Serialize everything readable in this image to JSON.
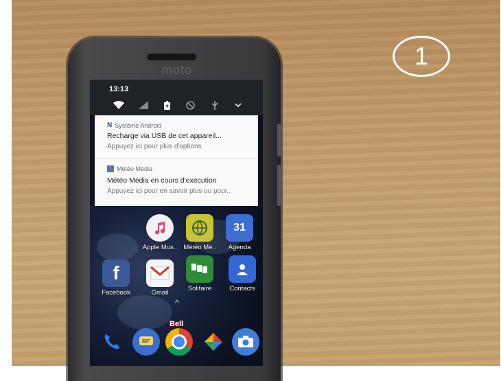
{
  "step_badge": "1",
  "phone": {
    "brand": "moto"
  },
  "statusbar": {
    "time": "13:13",
    "quick_settings": [
      "wifi-icon",
      "signal-icon",
      "battery-icon",
      "do-not-disturb-icon",
      "usb-icon",
      "chevron-down-icon"
    ]
  },
  "notifications": [
    {
      "app": "Système Android",
      "title": "Recharge via USB de cet appareil...",
      "text": "Appuyez ici pour plus d'options."
    },
    {
      "app": "Météo Média",
      "title": "Météo Média en cours d'exécution",
      "text": "Appuyez ici pour en savoir plus ou pour.."
    }
  ],
  "home": {
    "apps": [
      {
        "label": "Apple Mus..",
        "icon": "music-icon"
      },
      {
        "label": "Météo Mé..",
        "icon": "weather-icon"
      },
      {
        "label": "Agenda",
        "icon": "calendar-icon",
        "badge": "31"
      },
      {
        "label": "Facebook",
        "icon": "facebook-icon"
      },
      {
        "label": "Gmail",
        "icon": "gmail-icon"
      },
      {
        "label": "Solitaire",
        "icon": "cards-icon"
      },
      {
        "label": "Contacts",
        "icon": "contacts-icon"
      }
    ],
    "dock": [
      {
        "icon": "phone-icon"
      },
      {
        "icon": "messages-icon"
      },
      {
        "icon": "chrome-icon",
        "overlay": "Bell"
      },
      {
        "icon": "photos-icon"
      },
      {
        "icon": "camera-icon"
      }
    ]
  },
  "colors": {
    "wood": "#c29b69",
    "notification_bg": "#fafafa",
    "statusbar_bg": "#1f2327"
  }
}
